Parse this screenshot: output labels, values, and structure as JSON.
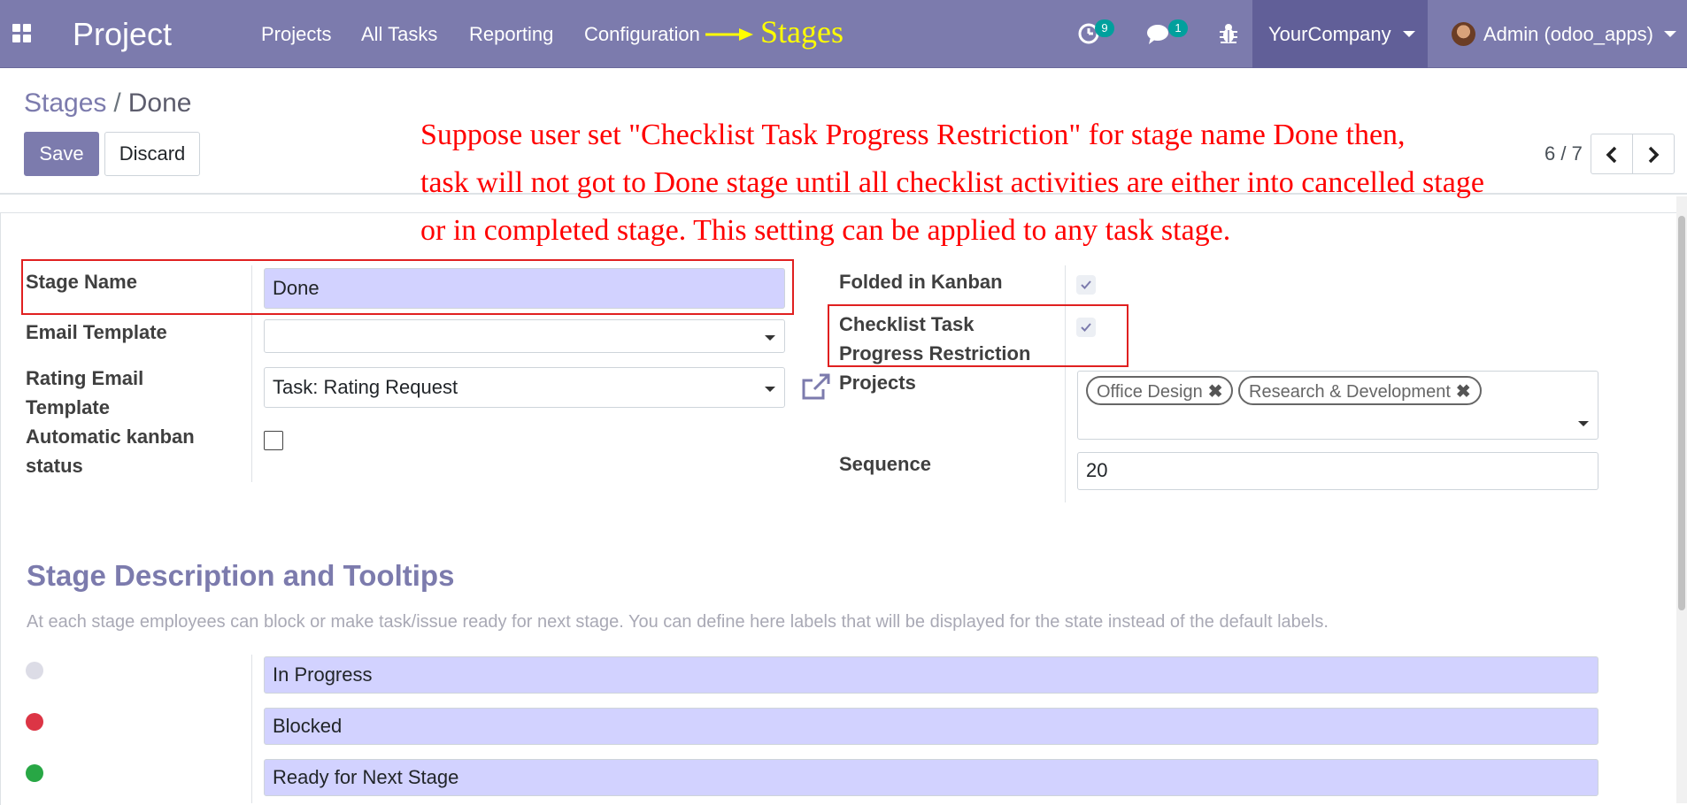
{
  "navbar": {
    "app_name": "Project",
    "menu": [
      "Projects",
      "All Tasks",
      "Reporting",
      "Configuration"
    ],
    "annotation_stages": "Stages",
    "activity_count": "9",
    "message_count": "1",
    "company": "YourCompany",
    "user": "Admin (odoo_apps)",
    "icons": [
      "apps-icon",
      "activity-clock-icon",
      "chat-icon",
      "bug-icon"
    ],
    "colors": {
      "brand": "#7c7bad",
      "company_bg": "#615f98",
      "badge": "#00a09d"
    }
  },
  "control_panel": {
    "breadcrumb_parent": "Stages",
    "breadcrumb_sep": "/",
    "breadcrumb_current": "Done",
    "save_label": "Save",
    "discard_label": "Discard",
    "pager": "6 / 7"
  },
  "annotation": {
    "line1": "Suppose user set \"Checklist Task Progress Restriction\" for stage name Done then,",
    "line2": "task will not got to Done stage until all checklist activities are either into cancelled stage",
    "line3": "or in completed stage. This setting can be applied to any task stage.",
    "color": "#ff0000"
  },
  "form": {
    "stage_name_label": "Stage Name",
    "stage_name_value": "Done",
    "email_template_label": "Email Template",
    "email_template_value": "",
    "rating_template_label_1": "Rating Email",
    "rating_template_label_2": "Template",
    "rating_template_value": "Task: Rating Request",
    "auto_kanban_label_1": "Automatic kanban",
    "auto_kanban_label_2": "status",
    "auto_kanban_checked": false,
    "folded_label": "Folded in Kanban",
    "folded_checked": true,
    "checklist_label_1": "Checklist Task",
    "checklist_label_2": "Progress Restriction",
    "checklist_checked": true,
    "projects_label": "Projects",
    "projects_tags": [
      "Office Design",
      "Research & Development"
    ],
    "sequence_label": "Sequence",
    "sequence_value": "20"
  },
  "tooltips": {
    "title": "Stage Description and Tooltips",
    "description": "At each stage employees can block or make task/issue ready for next stage. You can define here labels that will be displayed for the state instead of the default labels.",
    "states": [
      {
        "color": "#dcdce6",
        "label": "In Progress"
      },
      {
        "color": "#dc3545",
        "label": "Blocked"
      },
      {
        "color": "#28a745",
        "label": "Ready for Next Stage"
      }
    ]
  }
}
